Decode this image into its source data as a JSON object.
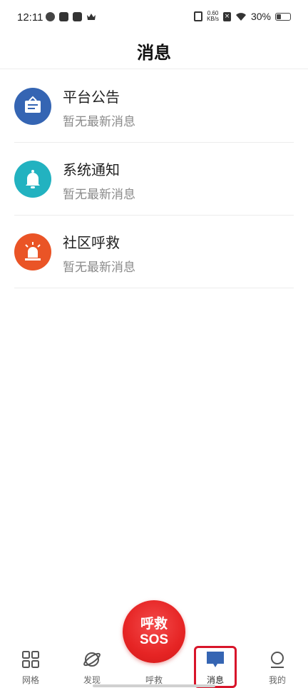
{
  "status_bar": {
    "time": "12:11",
    "net_speed_value": "0.60",
    "net_speed_unit": "KB/s",
    "battery": "30%"
  },
  "header": {
    "title": "消息"
  },
  "messages": [
    {
      "title": "平台公告",
      "subtitle": "暂无最新消息",
      "icon": "announcement-icon",
      "color": "#3565b3"
    },
    {
      "title": "系统通知",
      "subtitle": "暂无最新消息",
      "icon": "bell-icon",
      "color": "#22b2c0"
    },
    {
      "title": "社区呼救",
      "subtitle": "暂无最新消息",
      "icon": "alarm-light-icon",
      "color": "#ea5426"
    }
  ],
  "bottom_nav": {
    "tabs": [
      {
        "label": "网格",
        "icon": "grid-icon"
      },
      {
        "label": "发现",
        "icon": "planet-icon"
      },
      {
        "label": "呼救",
        "icon": "sos-icon"
      },
      {
        "label": "消息",
        "icon": "message-icon",
        "active": true
      },
      {
        "label": "我的",
        "icon": "user-icon"
      }
    ],
    "sos_line1": "呼救",
    "sos_line2": "SOS"
  },
  "colors": {
    "active_tab": "#3565b3",
    "sos_red": "#e62424",
    "highlight_border": "#d8152a"
  }
}
